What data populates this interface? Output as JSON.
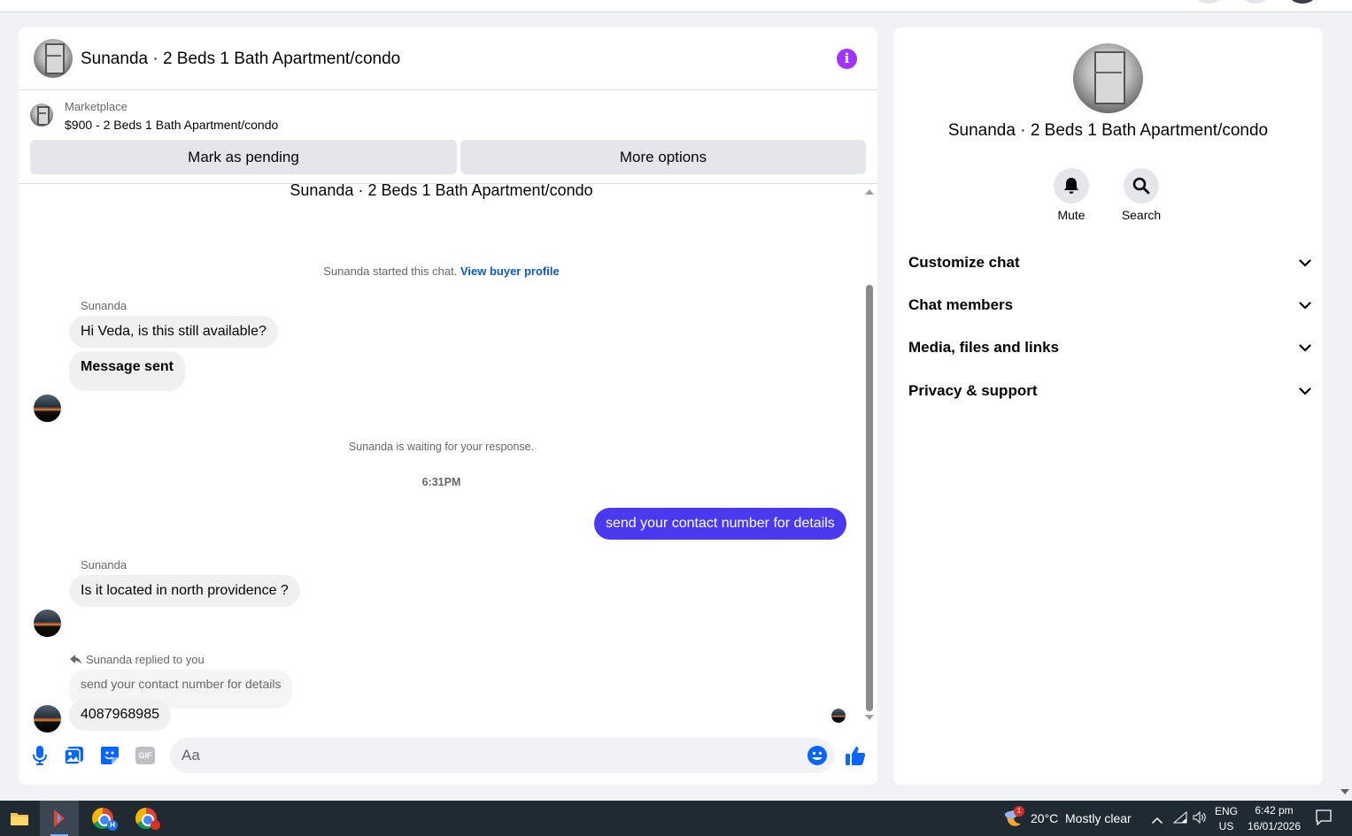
{
  "chat": {
    "title": "Sunanda · 2 Beds 1 Bath Apartment/condo",
    "marketplace_label": "Marketplace",
    "listing_price_title": "$900 - 2 Beds 1 Bath Apartment/condo",
    "mark_pending_label": "Mark as pending",
    "more_options_label": "More options"
  },
  "thread": {
    "title": "Sunanda · 2 Beds 1 Bath Apartment/condo",
    "started_text": "Sunanda started this chat.",
    "view_profile_link": "View buyer profile",
    "sender1": "Sunanda",
    "msg1": "Hi Veda, is this still available?",
    "msg2": "Message sent",
    "waiting_text": "Sunanda is waiting for your response.",
    "timestamp": "6:31PM",
    "out_msg": "send your contact number for details",
    "sender2": "Sunanda",
    "msg3": "Is it located in north providence ?",
    "reply_note": "Sunanda replied to you",
    "reply_quote": "send your contact number for details",
    "msg4": "4087968985"
  },
  "composer": {
    "placeholder": "Aa",
    "icons": [
      "microphone-icon",
      "photo-icon",
      "sticker-icon",
      "gif-icon",
      "emoji-icon",
      "thumbs-up-icon"
    ],
    "gif_label": "GIF"
  },
  "side": {
    "name": "Sunanda · 2 Beds 1 Bath Apartment/condo",
    "mute_label": "Mute",
    "search_label": "Search",
    "sections": [
      "Customize chat",
      "Chat members",
      "Media, files and links",
      "Privacy & support"
    ]
  },
  "taskbar": {
    "weather_badge": "1",
    "weather": "20°C",
    "weather_desc": "Mostly clear",
    "lang": "ENG",
    "region": "US",
    "time": "6:42 pm",
    "date": "16/01/2026",
    "chrome_badge": "H"
  },
  "colors": {
    "accent": "#4b39ef",
    "info": "#a033ff",
    "link": "#0a58ca",
    "icon_blue": "#0866ff"
  }
}
